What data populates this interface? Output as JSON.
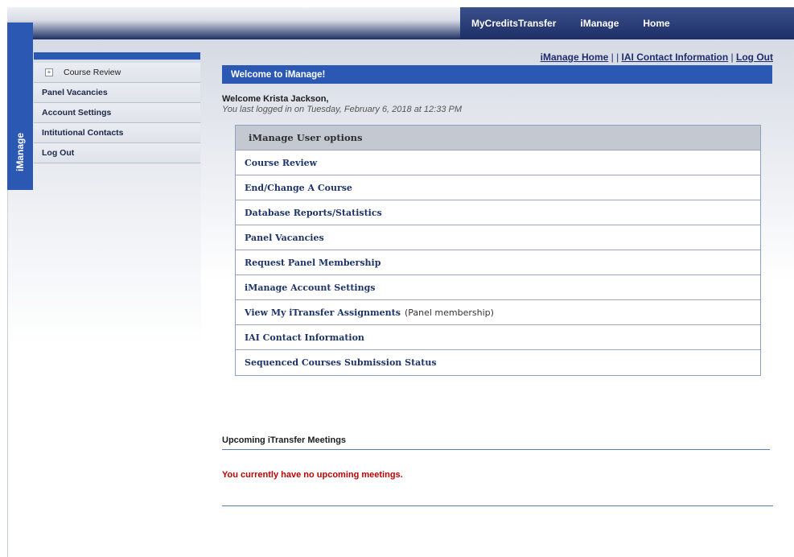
{
  "top_nav": {
    "items": [
      "MyCreditsTransfer",
      "iManage",
      "Home"
    ]
  },
  "side_tab": {
    "label": "iManage"
  },
  "left_menu": {
    "items": [
      "Course Review",
      "Panel Vacancies",
      "Account Settings",
      "Intitutional Contacts",
      "Log Out"
    ]
  },
  "top_links": {
    "home": "iManage Home",
    "sep1": " | | ",
    "contact": "IAI Contact Information",
    "sep2": " | ",
    "logout": "Log Out"
  },
  "welcome": {
    "bar_title": "Welcome to iManage!",
    "greeting": "Welcome Krista Jackson,",
    "last_login": "You last logged in on Tuesday, February 6, 2018 at 12:33 PM"
  },
  "options": {
    "header": "iManage User options",
    "items": [
      {
        "label": "Course Review",
        "note": ""
      },
      {
        "label": "End/Change A Course",
        "note": ""
      },
      {
        "label": "Database Reports/Statistics",
        "note": ""
      },
      {
        "label": "Panel Vacancies",
        "note": ""
      },
      {
        "label": "Request Panel Membership",
        "note": ""
      },
      {
        "label": "iManage Account Settings",
        "note": ""
      },
      {
        "label": "View My iTransfer Assignments",
        "note": "(Panel membership)"
      },
      {
        "label": "IAI Contact Information",
        "note": ""
      },
      {
        "label": "Sequenced Courses Submission Status",
        "note": ""
      }
    ]
  },
  "meetings": {
    "title": "Upcoming iTransfer Meetings",
    "message": "You currently have no upcoming meetings."
  },
  "colors": {
    "accent": "#2b58b3",
    "nav_dark": "#1e2f66",
    "alert": "#c00000"
  }
}
